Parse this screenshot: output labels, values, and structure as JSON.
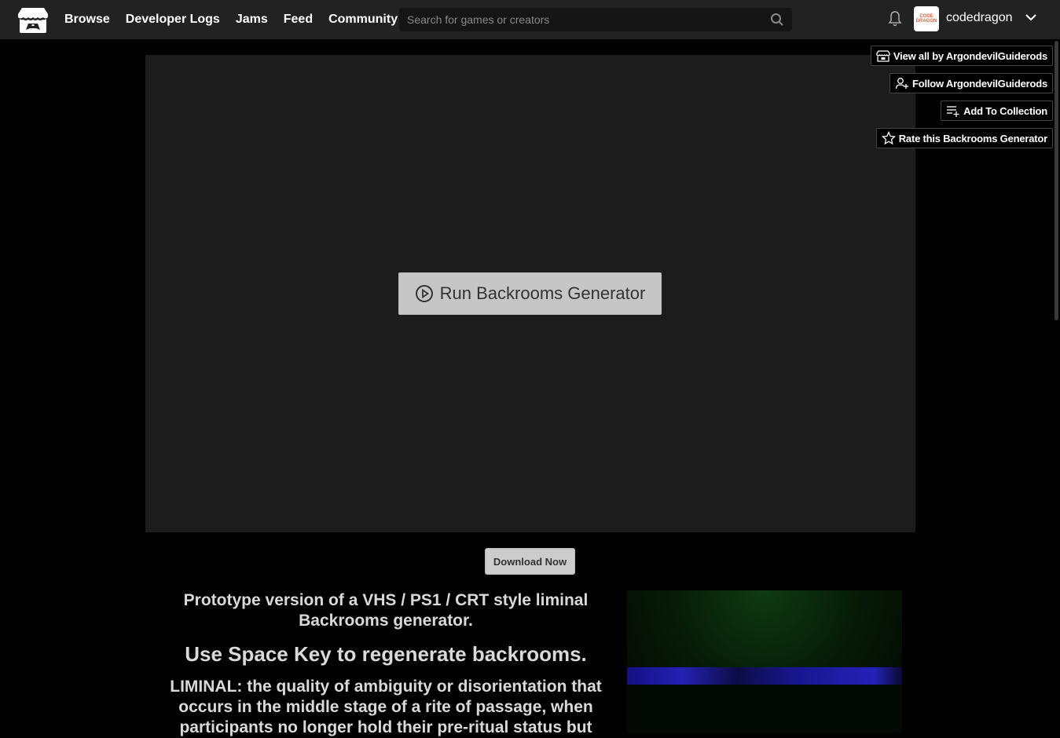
{
  "header": {
    "nav": [
      "Browse",
      "Developer Logs",
      "Jams",
      "Feed",
      "Community"
    ],
    "search_placeholder": "Search for games or creators",
    "username": "codedragon",
    "avatar_text": "CODE DRAGON"
  },
  "game": {
    "run_label": "Run Backrooms Generator"
  },
  "side_actions": {
    "view_all": "View all by ArgondevilGuiderods",
    "follow": "Follow ArgondevilGuiderods",
    "add_collection": "Add To Collection",
    "rate": "Rate this Backrooms Generator"
  },
  "download_label": "Download Now",
  "description": {
    "p1": "Prototype version of a VHS / PS1 / CRT style liminal Backrooms generator.",
    "p2": "Use Space Key to regenerate backrooms.",
    "p3": "LIMINAL: the quality of ambiguity or disorientation that occurs in the middle stage of a rite of passage, when participants no longer hold their pre-ritual status but"
  },
  "colors": {
    "header_bg": "#222222",
    "page_bg": "#000000",
    "frame_bg": "#1c1c1c",
    "button_bg": "#c6c6c6"
  }
}
